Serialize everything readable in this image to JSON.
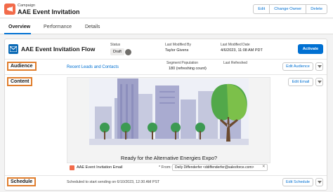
{
  "header": {
    "object_type": "Campaign",
    "title": "AAE Event Invitation",
    "buttons": [
      "Edit",
      "Change Owner",
      "Delete"
    ]
  },
  "tabs": [
    "Overview",
    "Performance",
    "Details"
  ],
  "flow": {
    "title": "AAE Event Invitation Flow",
    "status_label": "Status",
    "status_value": "Draft",
    "last_modified_by_label": "Last Modified By",
    "last_modified_by_value": "Taylor Givens",
    "last_modified_date_label": "Last Modified Date",
    "last_modified_date_value": "4/6/2023, 11:08 AM PDT",
    "activate_label": "Activate"
  },
  "audience": {
    "label": "Audience",
    "link": "Recent Leads and Contacts",
    "segment_population_label": "Segment Population",
    "segment_population_value": "180 (refreshing count)",
    "last_refreshed_label": "Last Refreshed",
    "edit_button": "Edit Audience"
  },
  "content": {
    "label": "Content",
    "edit_button": "Edit Email",
    "email_heading": "Ready for the Alternative Energies Expo?",
    "email_name": "AAE Event Invitation Email",
    "from_label": "* From:",
    "from_value": "Deily Diffenderfer <ddiffenderfer@salesforce.com>"
  },
  "schedule": {
    "label": "Schedule",
    "text": "Scheduled to start sending on 6/10/2023, 12:30 AM PST",
    "edit_button": "Edit Schedule"
  },
  "colors": {
    "brand_blue": "#0070d2",
    "campaign_orange": "#f26b4a",
    "highlight_orange": "#e07d2c"
  }
}
